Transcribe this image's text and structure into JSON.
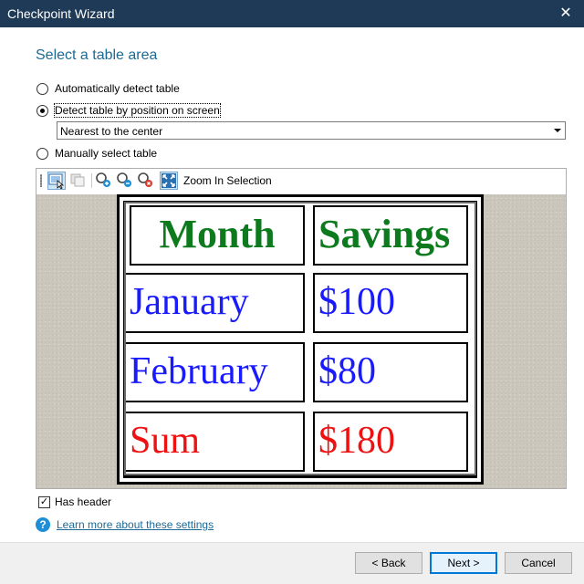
{
  "window": {
    "title": "Checkpoint Wizard",
    "close_glyph": "✕"
  },
  "heading": "Select a table area",
  "options": {
    "auto": "Automatically detect table",
    "position": "Detect table by position on screen",
    "manual": "Manually select table",
    "selected": "position"
  },
  "position_select": {
    "value": "Nearest to the center"
  },
  "toolbar": {
    "zoom_label": "Zoom In Selection",
    "icons": [
      "select-area-icon",
      "copy-icon",
      "zoom-in-icon",
      "zoom-out-icon",
      "zoom-reset-icon",
      "zoom-selection-icon"
    ]
  },
  "table": {
    "headers": [
      "Month",
      "Savings"
    ],
    "rows": [
      [
        "January",
        "$100"
      ],
      [
        "February",
        "$80"
      ],
      [
        "Sum",
        "$180"
      ]
    ],
    "colors": {
      "header": "#0d7a1e",
      "body": "#1a1aff",
      "sum": "#ee1111"
    }
  },
  "has_header": {
    "label": "Has header",
    "checked": true
  },
  "help": {
    "link": "Learn more about these settings"
  },
  "buttons": {
    "back": "< Back",
    "next": "Next >",
    "cancel": "Cancel"
  }
}
